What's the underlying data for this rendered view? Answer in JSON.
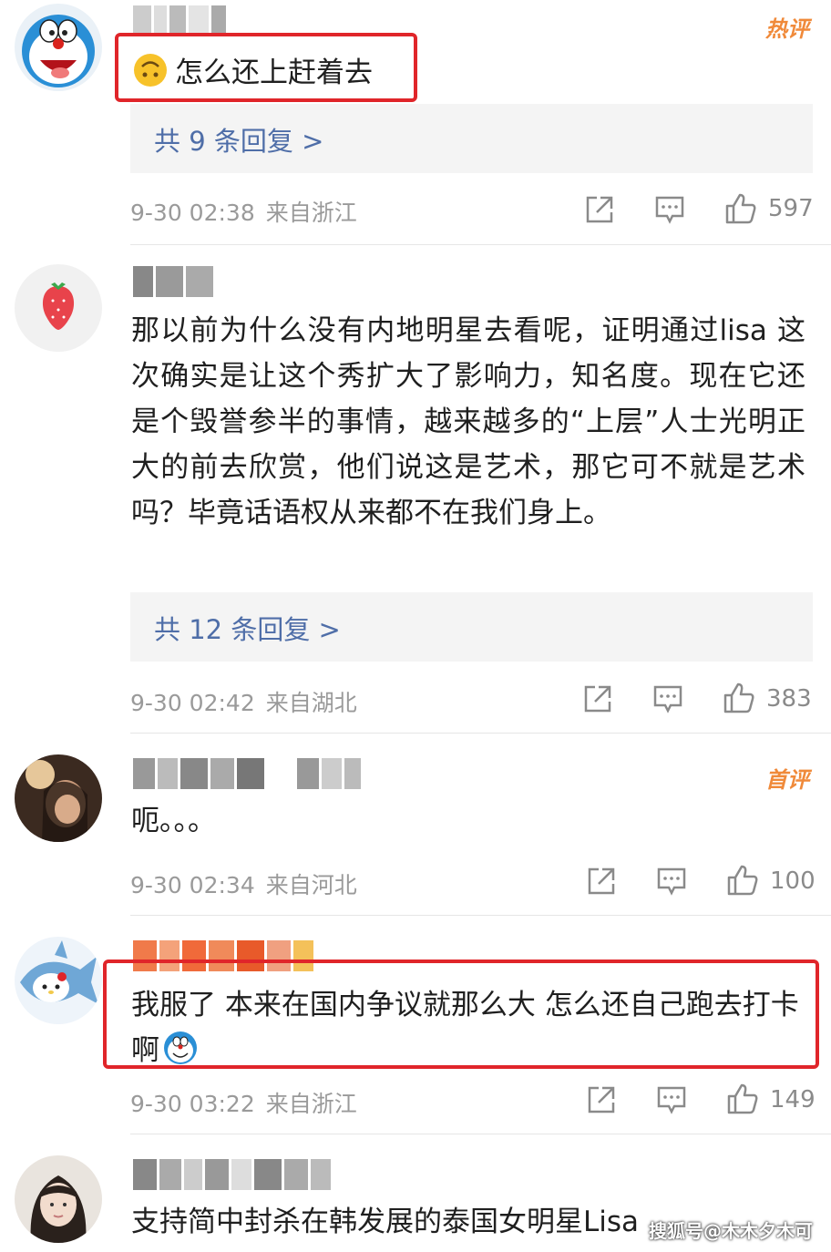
{
  "comments": [
    {
      "text": "怎么还上赶着去",
      "emoji": "upside-down-face-emoji",
      "tag": "热评",
      "replies": "共 9 条回复 >",
      "time": "9-30 02:38",
      "location": "来自浙江",
      "likes": "597"
    },
    {
      "text": "那以前为什么没有内地明星去看呢，证明通过lisa 这次确实是让这个秀扩大了影响力，知名度。现在它还是个毁誉参半的事情，越来越多的“上层”人士光明正大的前去欣赏，他们说这是艺术，那它可不就是艺术吗？毕竟话语权从来都不在我们身上。",
      "replies": "共 12 条回复 >",
      "time": "9-30 02:42",
      "location": "来自湖北",
      "likes": "383"
    },
    {
      "text": "呃。。。",
      "tag": "首评",
      "time": "9-30 02:34",
      "location": "来自河北",
      "likes": "100"
    },
    {
      "text": "我服了 本来在国内争议就那么大 怎么还自己跑去打卡啊",
      "emoji": "doraemon-emoji",
      "time": "9-30 03:22",
      "location": "来自浙江",
      "likes": "149"
    },
    {
      "text": "支持简中封杀在韩发展的泰国女明星Lisa"
    }
  ],
  "watermark": "搜狐号@木木夕木可",
  "colors": {
    "highlight": "#e0252a",
    "reply_link": "#4f6ea8",
    "hot_tag": "#f08a3a",
    "meta_text": "#9a9a9a"
  }
}
